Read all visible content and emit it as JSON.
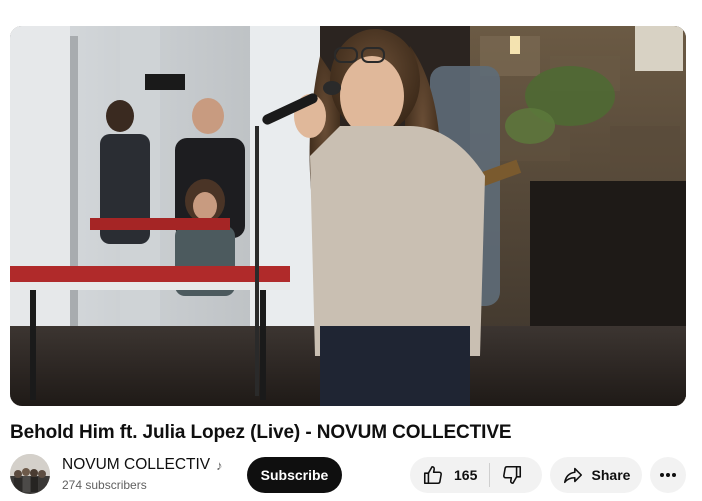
{
  "video": {
    "title": "Behold Him ft. Julia Lopez (Live) - NOVUM COLLECTIVE",
    "thumbnail_description_icon": "video-frame"
  },
  "channel": {
    "name": "NOVUM COLLECTIV",
    "badge_icon": "music-note-icon",
    "badge_glyph": "♪",
    "subscribers": "274 subscribers"
  },
  "actions": {
    "subscribe_label": "Subscribe",
    "like_count": "165",
    "like_icon": "thumbs-up-icon",
    "dislike_icon": "thumbs-down-icon",
    "share_label": "Share",
    "share_icon": "share-arrow-icon",
    "more_icon": "more-horizontal-icon"
  },
  "colors": {
    "subscribe_bg": "#0f0f0f",
    "pill_bg": "#f2f2f2",
    "text_primary": "#0f0f0f",
    "text_secondary": "#606060"
  }
}
